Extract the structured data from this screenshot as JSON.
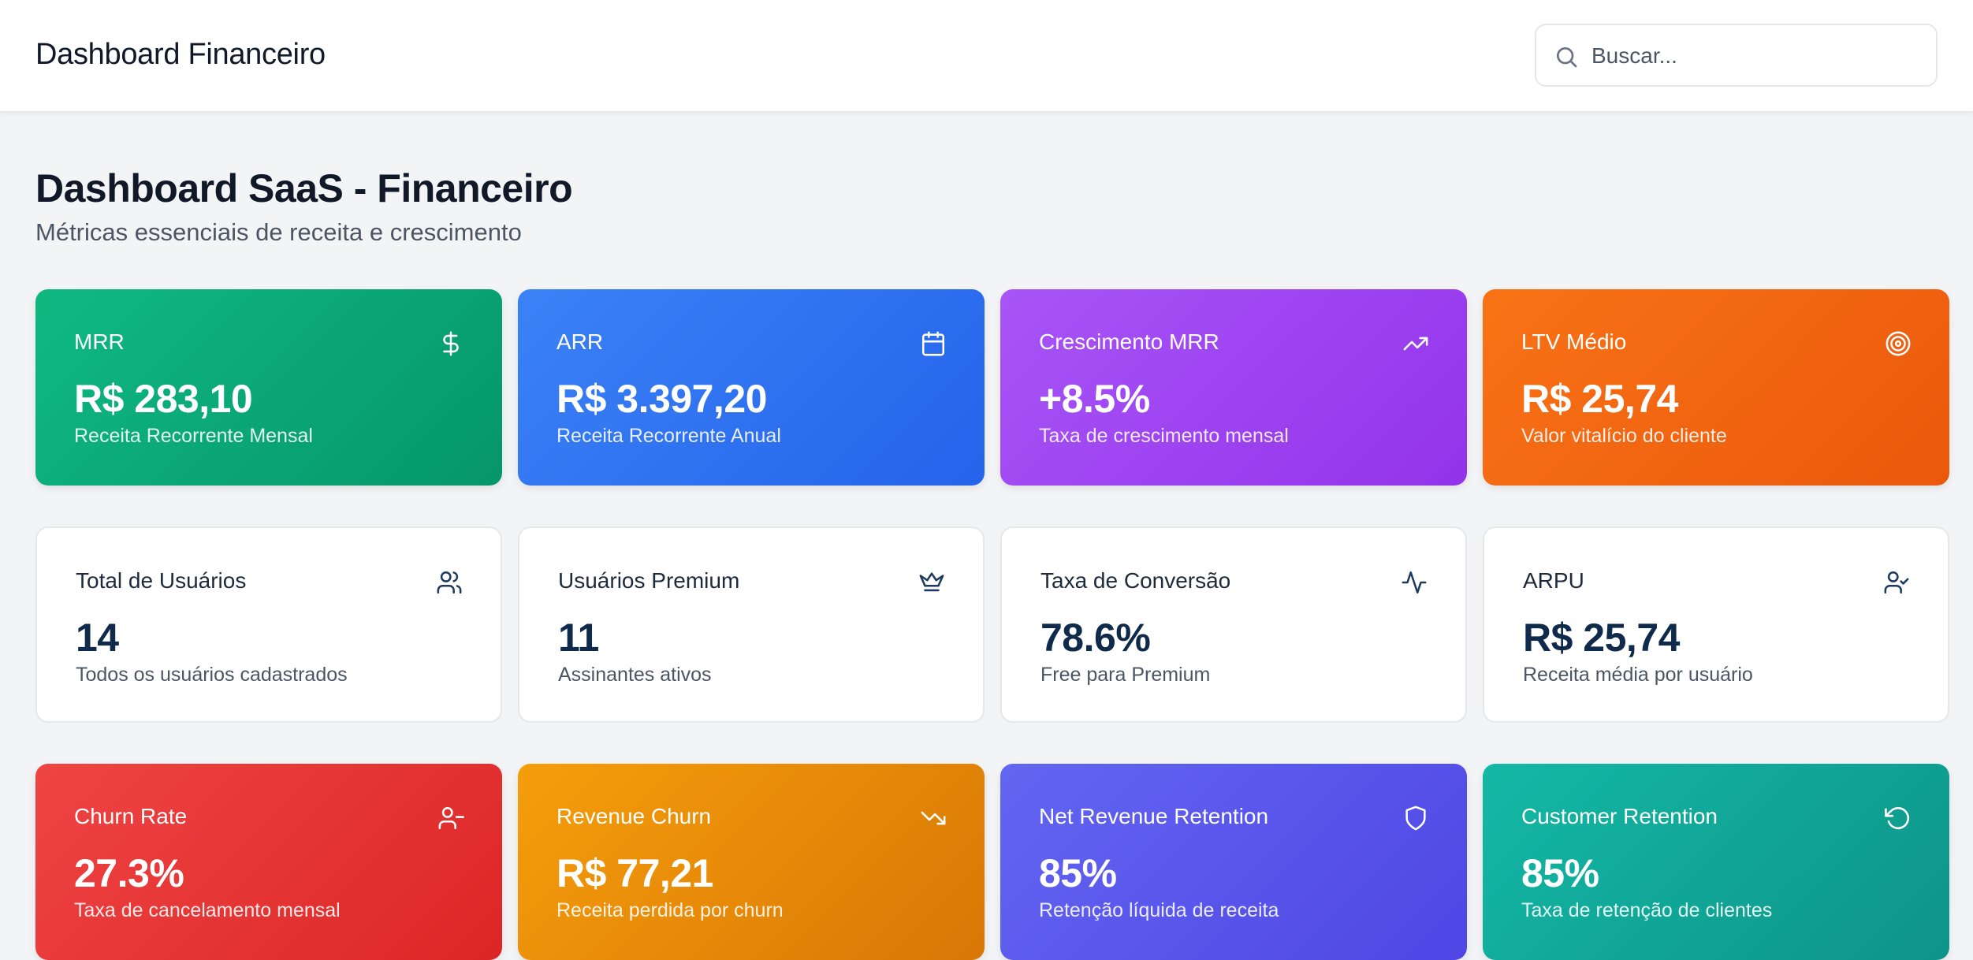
{
  "header": {
    "title": "Dashboard Financeiro",
    "search_placeholder": "Buscar..."
  },
  "page": {
    "title": "Dashboard SaaS - Financeiro",
    "subtitle": "Métricas essenciais de receita e crescimento"
  },
  "cards": [
    {
      "label": "MRR",
      "value": "R$ 283,10",
      "desc": "Receita Recorrente Mensal",
      "icon": "dollar-icon",
      "color": "#10b981"
    },
    {
      "label": "ARR",
      "value": "R$ 3.397,20",
      "desc": "Receita Recorrente Anual",
      "icon": "calendar-icon",
      "color": "#3b82f6"
    },
    {
      "label": "Crescimento MRR",
      "value": "+8.5%",
      "desc": "Taxa de crescimento mensal",
      "icon": "trending-up-icon",
      "color": "#a855f7"
    },
    {
      "label": "LTV Médio",
      "value": "R$ 25,74",
      "desc": "Valor vitalício do cliente",
      "icon": "target-icon",
      "color": "#f97316"
    },
    {
      "label": "Total de Usuários",
      "value": "14",
      "desc": "Todos os usuários cadastrados",
      "icon": "users-icon",
      "color": "#ffffff"
    },
    {
      "label": "Usuários Premium",
      "value": "11",
      "desc": "Assinantes ativos",
      "icon": "crown-icon",
      "color": "#ffffff"
    },
    {
      "label": "Taxa de Conversão",
      "value": "78.6%",
      "desc": "Free para Premium",
      "icon": "activity-icon",
      "color": "#ffffff"
    },
    {
      "label": "ARPU",
      "value": "R$ 25,74",
      "desc": "Receita média por usuário",
      "icon": "user-check-icon",
      "color": "#ffffff"
    },
    {
      "label": "Churn Rate",
      "value": "27.3%",
      "desc": "Taxa de cancelamento mensal",
      "icon": "user-minus-icon",
      "color": "#ef4444"
    },
    {
      "label": "Revenue Churn",
      "value": "R$ 77,21",
      "desc": "Receita perdida por churn",
      "icon": "trending-down-icon",
      "color": "#f59e0b"
    },
    {
      "label": "Net Revenue Retention",
      "value": "85%",
      "desc": "Retenção líquida de receita",
      "icon": "shield-icon",
      "color": "#6366f1"
    },
    {
      "label": "Customer Retention",
      "value": "85%",
      "desc": "Taxa de retenção de clientes",
      "icon": "rotate-ccw-icon",
      "color": "#14b8a6"
    }
  ]
}
